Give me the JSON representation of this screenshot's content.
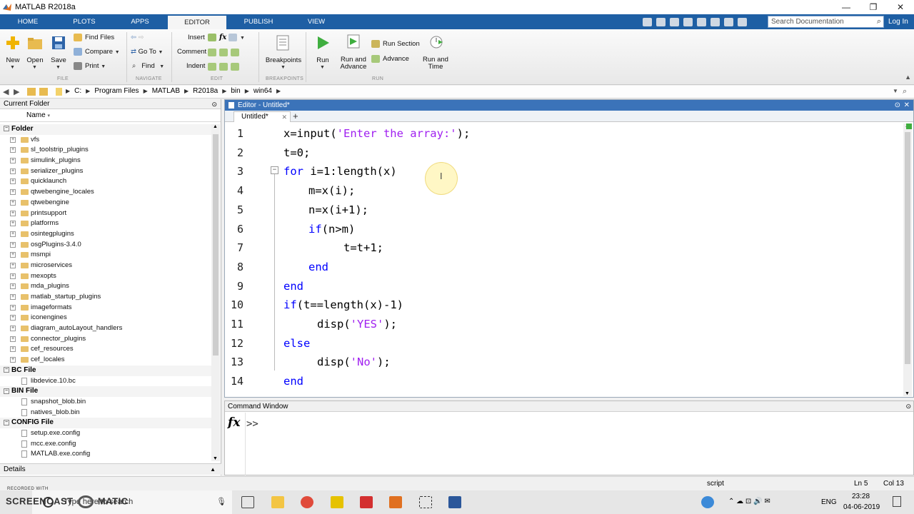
{
  "window": {
    "title": "MATLAB R2018a",
    "minimize": "—",
    "maximize": "❐",
    "close": "✕"
  },
  "ribbon_tabs": [
    "HOME",
    "PLOTS",
    "APPS",
    "EDITOR",
    "PUBLISH",
    "VIEW"
  ],
  "active_tab": "EDITOR",
  "search": {
    "placeholder": "Search Documentation"
  },
  "login": "Log In",
  "ribbon": {
    "file": {
      "new": "New",
      "open": "Open",
      "save": "Save",
      "find_files": "Find Files",
      "compare": "Compare",
      "print": "Print",
      "section": "FILE"
    },
    "navigate": {
      "go_to": "Go To",
      "find": "Find",
      "section": "NAVIGATE"
    },
    "edit": {
      "insert": "Insert",
      "comment": "Comment",
      "indent": "Indent",
      "section": "EDIT"
    },
    "breakpoints": {
      "label": "Breakpoints",
      "section": "BREAKPOINTS"
    },
    "run": {
      "run": "Run",
      "run_and_advance_1": "Run and",
      "run_and_advance_2": "Advance",
      "run_section": "Run Section",
      "advance": "Advance",
      "run_and_time_1": "Run and",
      "run_and_time_2": "Time",
      "section": "RUN"
    }
  },
  "address": {
    "crumbs": [
      "C:",
      "Program Files",
      "MATLAB",
      "R2018a",
      "bin",
      "win64"
    ]
  },
  "current_folder": {
    "title": "Current Folder",
    "column": "Name",
    "groups": [
      {
        "name": "Folder",
        "items": [
          "vfs",
          "sl_toolstrip_plugins",
          "simulink_plugins",
          "serializer_plugins",
          "quicklaunch",
          "qtwebengine_locales",
          "qtwebengine",
          "printsupport",
          "platforms",
          "osintegplugins",
          "osgPlugins-3.4.0",
          "msmpi",
          "microservices",
          "mexopts",
          "mda_plugins",
          "matlab_startup_plugins",
          "imageformats",
          "iconengines",
          "diagram_autoLayout_handlers",
          "connector_plugins",
          "cef_resources",
          "cef_locales"
        ]
      },
      {
        "name": "BC File",
        "items": [
          "libdevice.10.bc"
        ]
      },
      {
        "name": "BIN File",
        "items": [
          "snapshot_blob.bin",
          "natives_blob.bin"
        ]
      },
      {
        "name": "CONFIG File",
        "items": [
          "setup.exe.config",
          "mcc.exe.config",
          "MATLAB.exe.config"
        ]
      }
    ],
    "details": "Details"
  },
  "editor": {
    "title": "Editor - Untitled*",
    "tab": "Untitled*",
    "lines": [
      {
        "n": "1",
        "indent": 0,
        "parts": [
          [
            "plain",
            "x=input("
          ],
          [
            "str",
            "'Enter the array:'"
          ],
          [
            "plain",
            ");"
          ]
        ]
      },
      {
        "n": "2",
        "indent": 0,
        "parts": [
          [
            "plain",
            "t=0;"
          ]
        ]
      },
      {
        "n": "3",
        "indent": 0,
        "parts": [
          [
            "kw",
            "for"
          ],
          [
            "plain",
            " i=1:length(x)"
          ]
        ]
      },
      {
        "n": "4",
        "indent": 1,
        "parts": [
          [
            "plain",
            "m=x(i);"
          ]
        ]
      },
      {
        "n": "5",
        "indent": 1,
        "parts": [
          [
            "plain",
            "n=x(i+1);"
          ]
        ]
      },
      {
        "n": "6",
        "indent": 1,
        "parts": [
          [
            "kw",
            "if"
          ],
          [
            "plain",
            "(n>m)"
          ]
        ]
      },
      {
        "n": "7",
        "indent": 2,
        "parts": [
          [
            "plain",
            "t=t+1;"
          ]
        ]
      },
      {
        "n": "8",
        "indent": 1,
        "parts": [
          [
            "kw",
            "end"
          ]
        ]
      },
      {
        "n": "9",
        "indent": 0,
        "parts": [
          [
            "kw",
            "end"
          ]
        ]
      },
      {
        "n": "10",
        "indent": 0,
        "parts": [
          [
            "kw",
            "if"
          ],
          [
            "plain",
            "(t==length(x)-1)"
          ]
        ]
      },
      {
        "n": "11",
        "indent": 3,
        "parts": [
          [
            "plain",
            "disp("
          ],
          [
            "str",
            "'YES'"
          ],
          [
            "plain",
            ");"
          ]
        ]
      },
      {
        "n": "12",
        "indent": 0,
        "parts": [
          [
            "kw",
            "else"
          ]
        ]
      },
      {
        "n": "13",
        "indent": 3,
        "parts": [
          [
            "plain",
            "disp("
          ],
          [
            "str",
            "'No'"
          ],
          [
            "plain",
            ");"
          ]
        ]
      },
      {
        "n": "14",
        "indent": 0,
        "parts": [
          [
            "kw",
            "end"
          ]
        ]
      }
    ]
  },
  "command_window": {
    "title": "Command Window",
    "fx": "fx",
    "prompt": ">>"
  },
  "status": {
    "mode": "script",
    "ln": "Ln  5",
    "col": "Col  13"
  },
  "taskbar": {
    "search": "Type here to search",
    "lang": "ENG",
    "time": "23:28",
    "date": "04-06-2019",
    "watermark": "SCREENCAST",
    "watermark_small": "RECORDED WITH",
    "watermark_tail": "MATIC"
  },
  "colors": {
    "ribbon_blue": "#1e5fa4",
    "editor_title": "#3b73b9",
    "keyword": "#0000ff",
    "string": "#a020f0"
  }
}
